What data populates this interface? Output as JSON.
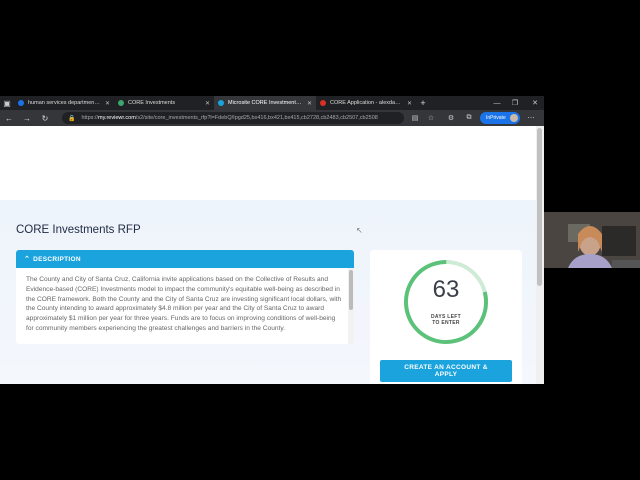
{
  "tabs": [
    {
      "label": "human services department sa...",
      "favicon_color": "#1a73e8",
      "active": false
    },
    {
      "label": "CORE Investments",
      "favicon_color": "#3aa76d",
      "active": false
    },
    {
      "label": "Microsite CORE Investments RFP",
      "favicon_color": "#1aa3dd",
      "active": true
    },
    {
      "label": "CORE Application - alexdami.Sl...",
      "favicon_color": "#d93025",
      "active": false
    }
  ],
  "address": {
    "protocol": "https://",
    "host": "my.reviewr.com",
    "path": "/s2/site/core_investments_rfp?l=FdebQ/Ipgd25,bx416,bx421,bx415,cb2728,cb2483,cb2507,cb2508"
  },
  "inprivate_label": "InPrivate",
  "page": {
    "title": "CORE Investments RFP",
    "description_header": "DESCRIPTION",
    "description_text": "The County and City of Santa Cruz, California invite applications based on the Collective of Results and Evidence-based (CORE) Investments model to impact the community's equitable well-being as described in the CORE framework. Both the County and the City of Santa Cruz are investing significant local dollars, with the County intending to award approximately $4.8 million per year and the City of Santa Cruz to award approximately $1 million per year for three years. Funds are to focus on improving conditions of well-being for community members experiencing the greatest challenges and barriers in the County.",
    "days_left": "63",
    "days_left_label_line1": "DAYS LEFT",
    "days_left_label_line2": "TO ENTER",
    "days_progress_fraction": 0.79,
    "apply_button_line1": "CREATE AN ACCOUNT &",
    "apply_button_line2": "APPLY"
  },
  "colors": {
    "accent": "#1aa3dd",
    "ring_fill": "#5cc279",
    "ring_track": "#cdebd5",
    "title": "#1f2a44"
  }
}
